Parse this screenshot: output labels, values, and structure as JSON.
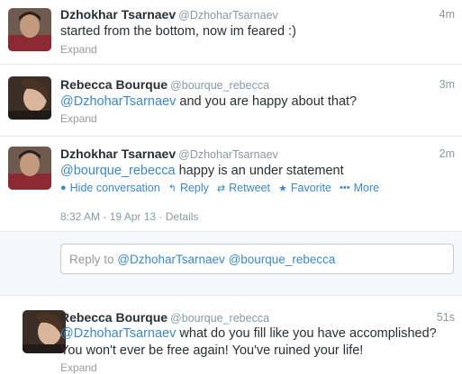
{
  "tweets": [
    {
      "name": "Dzhokhar Tsarnaev",
      "handle": "@DzhoharTsarnaev",
      "time": "4m",
      "text": "started from the bottom, now im feared :)",
      "expand": "Expand"
    },
    {
      "name": "Rebecca Bourque",
      "handle": "@bourque_rebecca",
      "time": "3m",
      "mention": "@DzhoharTsarnaev",
      "text": " and you are happy about that?",
      "expand": "Expand"
    },
    {
      "name": "Dzhokhar Tsarnaev",
      "handle": "@DzhoharTsarnaev",
      "time": "2m",
      "mention": "@bourque_rebecca",
      "text": " happy is an under statement",
      "actions": {
        "hide": "Hide conversation",
        "reply": "Reply",
        "retweet": "Retweet",
        "favorite": "Favorite",
        "more": "More"
      },
      "timestamp": "8:32 AM - 19 Apr 13",
      "details": "Details"
    },
    {
      "name": "Rebecca Bourque",
      "handle": "@bourque_rebecca",
      "time": "51s",
      "mention": "@DzhoharTsarnaev",
      "line1": " what do you fill like you have accomplished?",
      "line2": "You won't ever be free again! You've ruined your life!",
      "expand": "Expand"
    }
  ],
  "reply_box": {
    "prefix": "Reply to ",
    "mention1": "@DzhoharTsarnaev",
    "mention2": "@bourque_rebecca"
  },
  "icons": {
    "hide": "chevron-icon",
    "reply": "reply-arrow-icon",
    "retweet": "retweet-icon",
    "favorite": "star-icon",
    "more": "dots-icon"
  },
  "colors": {
    "link": "#3b88c3",
    "muted": "#8899a6"
  }
}
